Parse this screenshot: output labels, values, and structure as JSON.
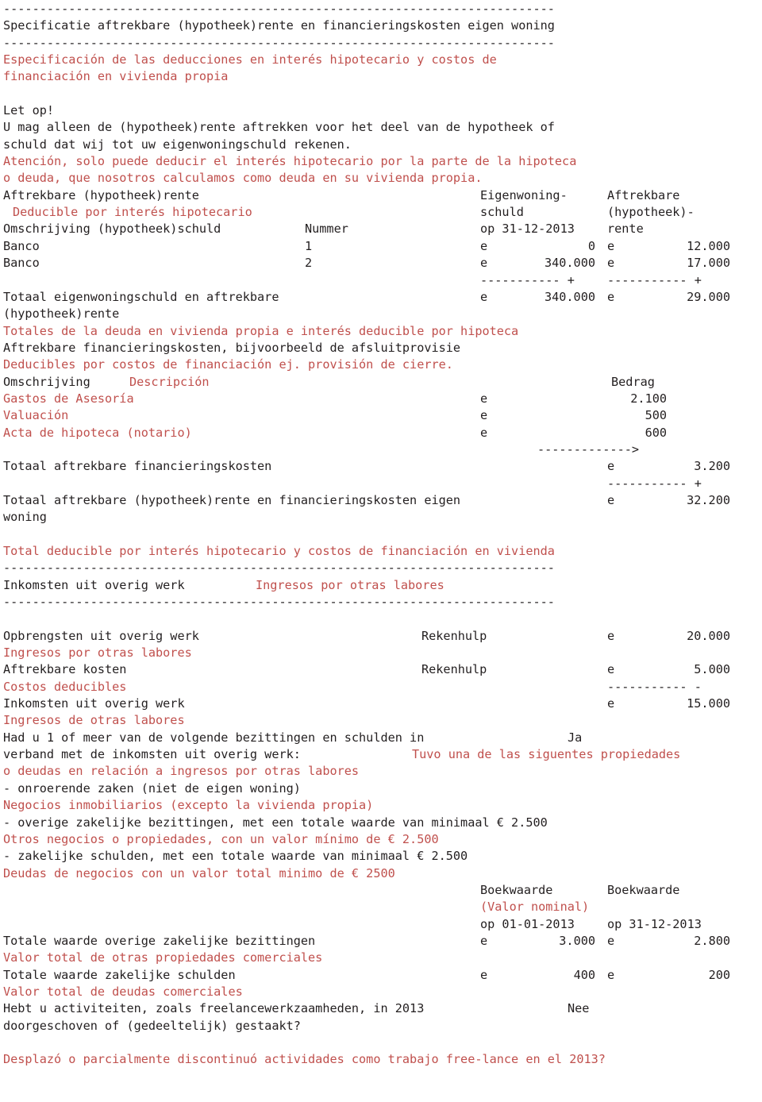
{
  "document": {
    "language_primary": "nl",
    "language_secondary": "es",
    "colors": {
      "text": "#231f20",
      "translation": "#c0504d",
      "background": "#ffffff"
    },
    "rules": {
      "long": "----------------------------------------------------------------------------"
    },
    "sections": {
      "mortgage": {
        "title_nl": "Specificatie aftrekbare (hypotheek)rente en financieringskosten eigen woning",
        "title_es_line1": "Especificación de las deducciones en interés hipotecario y costos de",
        "title_es_line2": "financiación en vivienda propia",
        "notice_label": "Let op!",
        "notice_nl_line1": "U mag alleen de (hypotheek)rente aftrekken voor het deel van de hypotheek of",
        "notice_nl_line2": "schuld dat wij tot uw eigenwoningschuld rekenen.",
        "notice_es_line1": "Atención, solo puede deducir el interés hipotecario por la parte de la hipoteca",
        "notice_es_line2": "o deuda, que nosotros calculamos como deuda en su vivienda propia.",
        "table_heading_nl": "Aftrekbare (hypotheek)rente",
        "table_heading_es": "Deducible por interés hipotecario",
        "col_head_desc": "Omschrijving (hypotheek)schuld",
        "col_head_number": "Nummer",
        "col_head_debt_line1": "Eigenwoning-",
        "col_head_debt_line2": "schuld",
        "col_head_debt_line3": "op 31-12-2013",
        "col_head_interest_line1": "Aftrekbare",
        "col_head_interest_line2": "(hypotheek)-",
        "col_head_interest_line3": "rente",
        "rows": [
          {
            "description": "Banco",
            "number": "1",
            "debt_currency": "e",
            "debt_amount": "0",
            "interest_currency": "e",
            "interest_amount": "12.000"
          },
          {
            "description": "Banco",
            "number": "2",
            "debt_currency": "e",
            "debt_amount": "340.000",
            "interest_currency": "e",
            "interest_amount": "17.000"
          }
        ],
        "subtotal_rule": "----------- +",
        "total_label_nl_line1": "Totaal eigenwoningschuld en aftrekbare",
        "total_label_nl_line2": "(hypotheek)rente",
        "total_label_es": "Totales de la deuda en vivienda propia e interés deducible por hipoteca",
        "total_debt_currency": "e",
        "total_debt_amount": "340.000",
        "total_interest_currency": "e",
        "total_interest_amount": "29.000"
      },
      "financing_costs": {
        "heading_nl": "Aftrekbare financieringskosten, bijvoorbeeld de afsluitprovisie",
        "heading_es": "Deducibles por costos de financiación ej. provisión de cierre.",
        "col_head_desc_nl": "Omschrijving",
        "col_head_desc_es": "Descripción",
        "col_head_amount": "Bedrag",
        "rows": [
          {
            "description": "Gastos de Asesoría",
            "currency": "e",
            "amount": "2.100"
          },
          {
            "description": "Valuación",
            "currency": "e",
            "amount": "500"
          },
          {
            "description": "Acta de hipoteca (notario)",
            "currency": "e",
            "amount": "600"
          }
        ],
        "arrow_rule": "------------->",
        "total_label": "Totaal aftrekbare financieringskosten",
        "total_currency": "e",
        "total_amount": "3.200",
        "grand_rule": "----------- +",
        "grand_total_label_line1": "Totaal aftrekbare (hypotheek)rente en financieringskosten eigen",
        "grand_total_label_line2": "woning",
        "grand_total_currency": "e",
        "grand_total_amount": "32.200",
        "grand_total_label_es": "Total deducible por interés hipotecario y costos de financiación en vivienda"
      },
      "other_work": {
        "heading_nl": "Inkomsten uit overig werk",
        "heading_es": "Ingresos por otras labores",
        "rows": [
          {
            "label_nl": "Opbrengsten uit overig werk",
            "label_es": "Ingresos por otras labores",
            "helper": "Rekenhulp",
            "currency": "e",
            "amount": "20.000",
            "rule": ""
          },
          {
            "label_nl": "Aftrekbare kosten",
            "label_es": "Costos deducibles",
            "helper": "Rekenhulp",
            "currency": "e",
            "amount": "5.000",
            "rule": "----------- -"
          },
          {
            "label_nl": "Inkomsten uit overig werk",
            "label_es": "Ingresos de otras labores",
            "helper": "",
            "currency": "e",
            "amount": "15.000",
            "rule": ""
          }
        ],
        "question_nl_line1": "Had u 1 of meer van de volgende bezittingen en schulden in",
        "question_nl_line2": "verband met de inkomsten uit overig werk:",
        "question_answer": "Ja",
        "question_es_line1": "Tuvo una de las siguentes propiedades",
        "question_es_line2": "o deudas en relación a ingresos por otras labores",
        "bullets": [
          {
            "nl": "- onroerende zaken (niet de eigen woning)",
            "es": "Negocios inmobiliarios (excepto la vivienda propia)"
          },
          {
            "nl": "- overige zakelijke bezittingen, met een totale waarde van minimaal € 2.500",
            "es": "Otros negocios o propiedades, con un valor mínimo de € 2.500"
          },
          {
            "nl": "- zakelijke schulden, met een totale waarde van minimaal € 2.500",
            "es": "Deudas de negocios con un valor total minimo de € 2500"
          }
        ],
        "book_value_head_1": "Boekwaarde",
        "book_value_head_2": "Boekwaarde",
        "book_value_head_es": "(Valor nominal)",
        "book_value_date_1": "op 01-01-2013",
        "book_value_date_2": "op 31-12-2013",
        "value_rows": [
          {
            "label_nl": "Totale waarde overige zakelijke bezittingen",
            "label_es": "Valor total de otras propiedades comerciales",
            "currency_1": "e",
            "amount_1": "3.000",
            "currency_2": "e",
            "amount_2": "2.800"
          },
          {
            "label_nl": "Totale waarde zakelijke schulden",
            "label_es": "Valor total de deudas comerciales",
            "currency_1": "e",
            "amount_1": "400",
            "currency_2": "e",
            "amount_2": "200"
          }
        ],
        "final_question_nl_line1": "Hebt u activiteiten, zoals freelancewerkzaamheden, in 2013",
        "final_question_nl_line2": "doorgeschoven of (gedeeltelijk) gestaakt?",
        "final_question_answer": "Nee",
        "final_question_es": "Desplazó o parcialmente discontinuó actividades como trabajo free-lance en el 2013?"
      }
    }
  }
}
